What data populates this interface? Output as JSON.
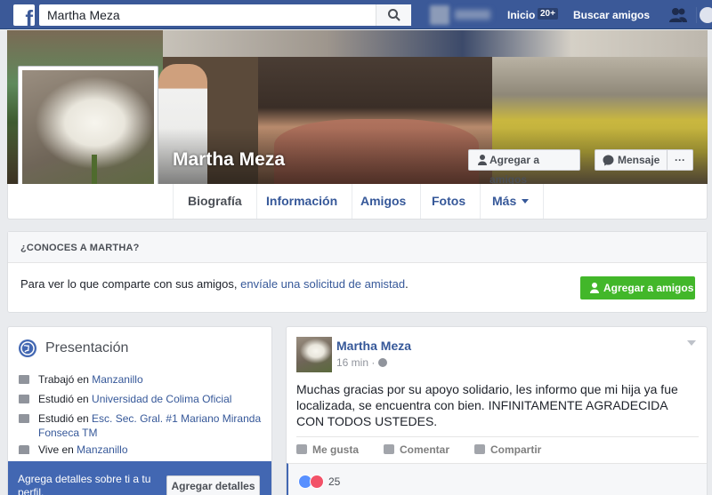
{
  "topbar": {
    "search_value": "Martha Meza",
    "home_label": "Inicio",
    "home_badge": "20+",
    "find_friends_label": "Buscar amigos"
  },
  "profile": {
    "name": "Martha Meza",
    "add_friend_label": "Agregar a amigos",
    "message_label": "Mensaje",
    "more_label": "···"
  },
  "tabs": [
    {
      "label": "Biografía"
    },
    {
      "label": "Información"
    },
    {
      "label": "Amigos"
    },
    {
      "label": "Fotos"
    },
    {
      "label": "Más"
    }
  ],
  "know": {
    "title": "¿CONOCES A MARTHA?",
    "text_before": "Para ver lo que comparte con sus amigos, ",
    "link": "envíale una solicitud de amistad",
    "text_after": ".",
    "button_label": "Agregar a amigos"
  },
  "intro": {
    "title": "Presentación",
    "items": [
      {
        "prefix": "Trabajó en ",
        "link": "Manzanillo"
      },
      {
        "prefix": "Estudió en ",
        "link": "Universidad de Colima Oficial"
      },
      {
        "prefix": "Estudió en ",
        "link": "Esc. Sec. Gral. #1 Mariano Miranda Fonseca TM"
      },
      {
        "prefix": "Vive en ",
        "link": "Manzanillo"
      }
    ],
    "footer_text": "Agrega detalles sobre ti a tu perfil.",
    "footer_button": "Agregar detalles"
  },
  "post": {
    "author": "Martha Meza",
    "time": "16 min ·",
    "text": "Muchas gracias por su apoyo solidario, les informo que mi hija ya fue localizada, se encuentra con bien. INFINITAMENTE AGRADECIDA CON TODOS USTEDES.",
    "like_label": "Me gusta",
    "comment_label": "Comentar",
    "share_label": "Compartir",
    "reaction_count": "25"
  }
}
